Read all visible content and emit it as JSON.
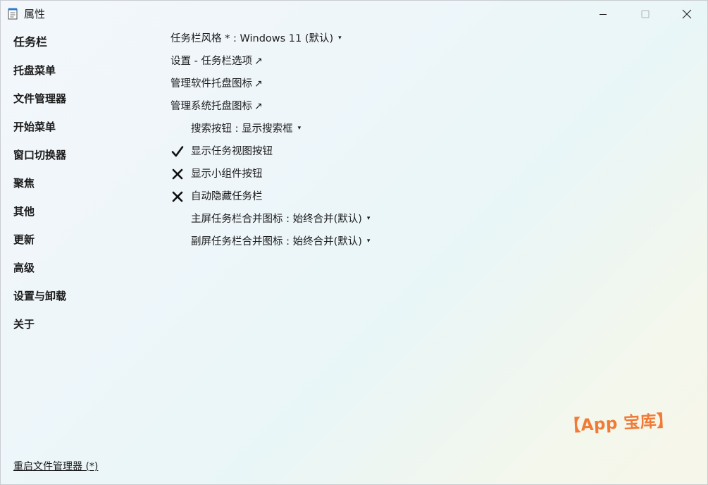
{
  "window": {
    "title": "属性",
    "app_icon": "notepad-icon",
    "controls": {
      "minimize_icon": "minimize-icon",
      "maximize_icon": "maximize-icon",
      "close_icon": "close-icon"
    }
  },
  "sidebar": {
    "items": [
      {
        "label": "任务栏",
        "active": true
      },
      {
        "label": "托盘菜单"
      },
      {
        "label": "文件管理器"
      },
      {
        "label": "开始菜单"
      },
      {
        "label": "窗口切换器"
      },
      {
        "label": "聚焦"
      },
      {
        "label": "其他"
      },
      {
        "label": "更新"
      },
      {
        "label": "高级"
      },
      {
        "label": "设置与卸载"
      },
      {
        "label": "关于"
      }
    ],
    "footer_link": "重启文件管理器 (*)"
  },
  "settings": {
    "taskbar_style": {
      "label": "任务栏风格 * : Windows 11 (默认)"
    },
    "taskbar_options_link": {
      "label": "设置 - 任务栏选项"
    },
    "manage_app_tray_link": {
      "label": "管理软件托盘图标"
    },
    "manage_system_tray_link": {
      "label": "管理系统托盘图标"
    },
    "search_button": {
      "label": "搜索按钮 : 显示搜索框"
    },
    "show_task_view": {
      "label": "显示任务视图按钮",
      "checked": true
    },
    "show_widgets": {
      "label": "显示小组件按钮",
      "checked": false
    },
    "auto_hide": {
      "label": "自动隐藏任务栏",
      "checked": false
    },
    "primary_combine": {
      "label": "主屏任务栏合并图标 : 始终合并(默认)"
    },
    "secondary_combine": {
      "label": "副屏任务栏合并图标 : 始终合并(默认)"
    },
    "glyphs": {
      "dropdown": "▾",
      "external": "↗"
    }
  },
  "watermark": "【App 宝库】",
  "colors": {
    "text": "#1b1b1b",
    "watermark": "#f07a36"
  }
}
